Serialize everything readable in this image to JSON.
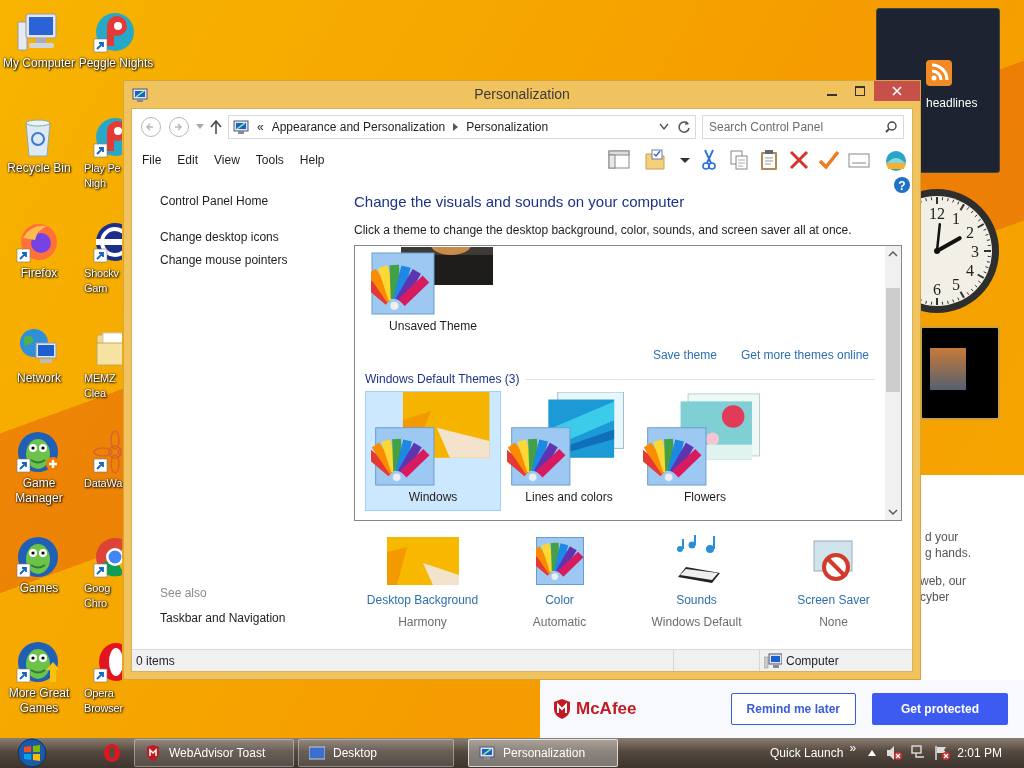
{
  "desktop_columns": [
    [
      {
        "lines": [
          "My Computer"
        ],
        "kind": "monitor",
        "shortcut": false
      },
      {
        "lines": [
          "Recycle Bin"
        ],
        "kind": "recycle",
        "shortcut": false
      },
      {
        "lines": [
          "Firefox"
        ],
        "kind": "firefox",
        "shortcut": true
      },
      {
        "lines": [
          "Network"
        ],
        "kind": "network",
        "shortcut": false
      },
      {
        "lines": [
          "Game",
          "Manager"
        ],
        "kind": "fishplus",
        "shortcut": true
      },
      {
        "lines": [
          "Games"
        ],
        "kind": "fish",
        "shortcut": true
      },
      {
        "lines": [
          "More Great",
          "Games"
        ],
        "kind": "fisharrow",
        "shortcut": true
      }
    ],
    [
      {
        "lines": [
          "Peggle Nights"
        ],
        "kind": "peggle",
        "shortcut": true
      },
      {
        "lines": [
          "Play Pe",
          "Nigh"
        ],
        "kind": "peggle",
        "shortcut": true
      },
      {
        "lines": [
          "Shockv",
          "Gam"
        ],
        "kind": "shockwave",
        "shortcut": true
      },
      {
        "lines": [
          "MEMZ",
          "Clea"
        ],
        "kind": "folder",
        "shortcut": false
      },
      {
        "lines": [
          "DataWa"
        ],
        "kind": "datawave",
        "shortcut": true
      },
      {
        "lines": [
          "Goog",
          "Chro"
        ],
        "kind": "chrome",
        "shortcut": true
      },
      {
        "lines": [
          "Opera",
          "Browser"
        ],
        "kind": "opera",
        "shortcut": true
      }
    ]
  ],
  "gadgets": {
    "headlines": "headlines",
    "clock_numerals": [
      "12",
      "1",
      "2",
      "3",
      "4",
      "5",
      "6"
    ]
  },
  "mcafee": {
    "text_lines": [
      "d your",
      "g hands.",
      "web, our",
      "cyber"
    ],
    "logo": "McAfee",
    "remind_button": "Remind me later",
    "protect_button": "Get protected"
  },
  "window": {
    "title": "Personalization",
    "nav": [
      {
        "kind": "back",
        "disabled": true
      },
      {
        "kind": "forward",
        "disabled": true
      }
    ],
    "breadcrumb": {
      "overflow": "«",
      "items": [
        "Appearance and Personalization",
        "Personalization"
      ]
    },
    "search": {
      "placeholder": "Search Control Panel"
    },
    "menu": [
      "File",
      "Edit",
      "View",
      "Tools",
      "Help"
    ],
    "help": "?",
    "sidebar": {
      "links": [
        "Control Panel Home",
        "Change desktop icons",
        "Change mouse pointers"
      ],
      "see_also": "See also",
      "see_also_links": [
        "Taskbar and Navigation"
      ]
    },
    "heading": "Change the visuals and sounds on your computer",
    "subtitle": "Click a theme to change the desktop background, color, sounds, and screen saver all at once.",
    "my_themes": [
      {
        "name": "Unsaved Theme",
        "kind": "unsaved",
        "selected": false
      }
    ],
    "theme_links": [
      "Save theme",
      "Get more themes online"
    ],
    "group_title": "Windows Default Themes (3)",
    "default_themes": [
      {
        "name": "Windows",
        "kind": "windows",
        "selected": true
      },
      {
        "name": "Lines and colors",
        "kind": "lines",
        "selected": false
      },
      {
        "name": "Flowers",
        "kind": "flowers",
        "selected": false
      }
    ],
    "settings": [
      {
        "kind": "background",
        "title": "Desktop Background",
        "value": "Harmony"
      },
      {
        "kind": "color",
        "title": "Color",
        "value": "Automatic"
      },
      {
        "kind": "sounds",
        "title": "Sounds",
        "value": "Windows Default"
      },
      {
        "kind": "screensaver",
        "title": "Screen Saver",
        "value": "None"
      }
    ],
    "status_bar": {
      "items": "0 items",
      "location": "Computer"
    }
  },
  "taskbar": {
    "tasks": [
      {
        "label": "WebAdvisor Toast",
        "kind": "mcafee",
        "selected": false
      },
      {
        "label": "Desktop",
        "kind": "desktop",
        "selected": false
      },
      {
        "label": "Personalization",
        "kind": "personalization",
        "selected": true
      }
    ],
    "quick_launch": "Quick Launch",
    "chevron": "»",
    "time": "2:01 PM"
  }
}
